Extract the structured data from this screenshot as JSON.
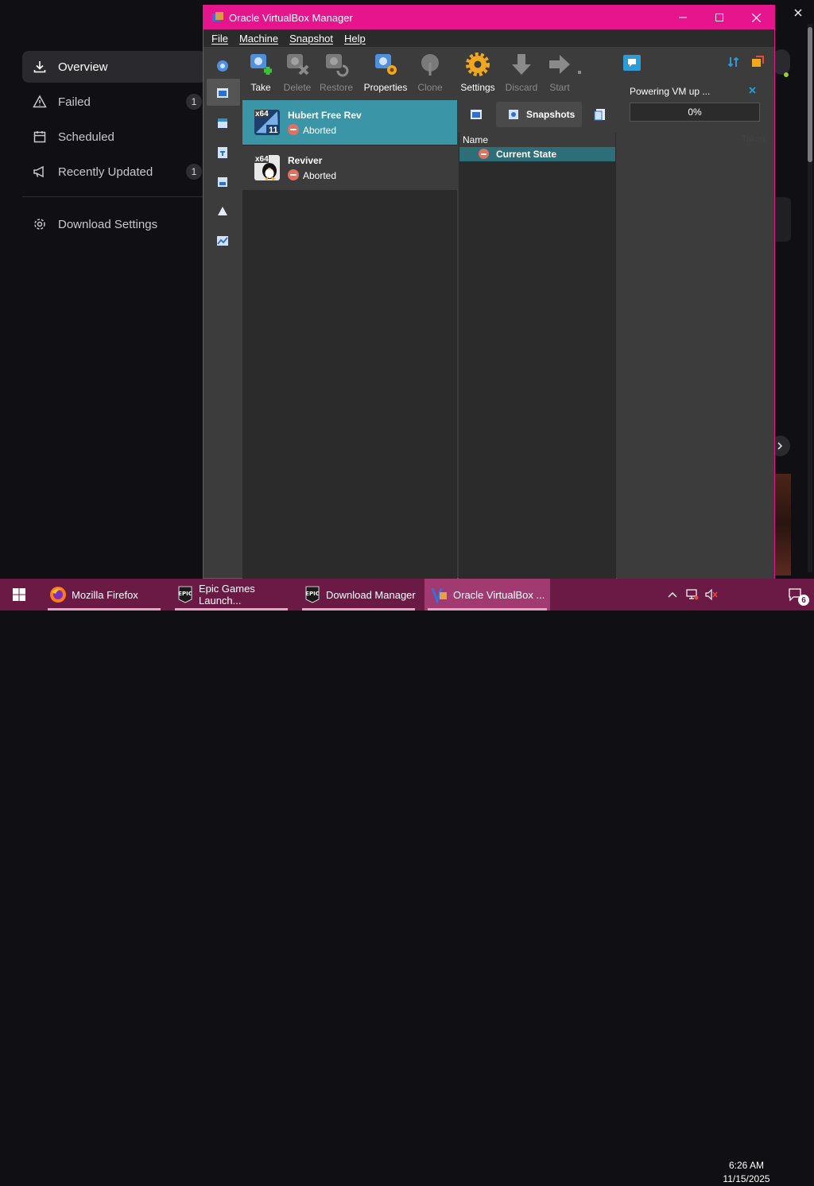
{
  "epic": {
    "nav": [
      {
        "label": "Overview",
        "count": ""
      },
      {
        "label": "Failed",
        "count": "1"
      },
      {
        "label": "Scheduled",
        "count": ""
      },
      {
        "label": "Recently Updated",
        "count": "1"
      },
      {
        "label": "Download Settings",
        "count": ""
      }
    ]
  },
  "vbox": {
    "title": "Oracle VirtualBox Manager",
    "menu": [
      "File",
      "Machine",
      "Snapshot",
      "Help"
    ],
    "toolbar": {
      "take": "Take",
      "delete": "Delete",
      "restore": "Restore",
      "properties": "Properties",
      "clone": "Clone",
      "settings": "Settings",
      "discard": "Discard",
      "start": "Start"
    },
    "vms": [
      {
        "name": "Hubert Free Rev",
        "state": "Aborted",
        "os_badge": "x64",
        "os_version": "11"
      },
      {
        "name": "Reviver",
        "state": "Aborted",
        "os_badge": "x64",
        "os_version": ""
      }
    ],
    "snapshots": {
      "tab_label": "Snapshots",
      "column_name": "Name",
      "column_taken": "Taken",
      "current_state": "Current State"
    },
    "progress": {
      "label": "Powering VM up ...",
      "value_text": "0%",
      "value": 0
    }
  },
  "taskbar": {
    "items": [
      {
        "label": "Mozilla Firefox"
      },
      {
        "label": "Epic Games Launch..."
      },
      {
        "label": "Download Manager"
      },
      {
        "label": "Oracle VirtualBox ..."
      }
    ],
    "time": "6:26 AM",
    "date": "11/15/2025",
    "notifications": "6"
  },
  "colors": {
    "title_bar": "#e6158e",
    "selected_vm": "#3a96a6",
    "taskbar": "#6b1a45",
    "progress_accent": "#2e9bd6"
  }
}
